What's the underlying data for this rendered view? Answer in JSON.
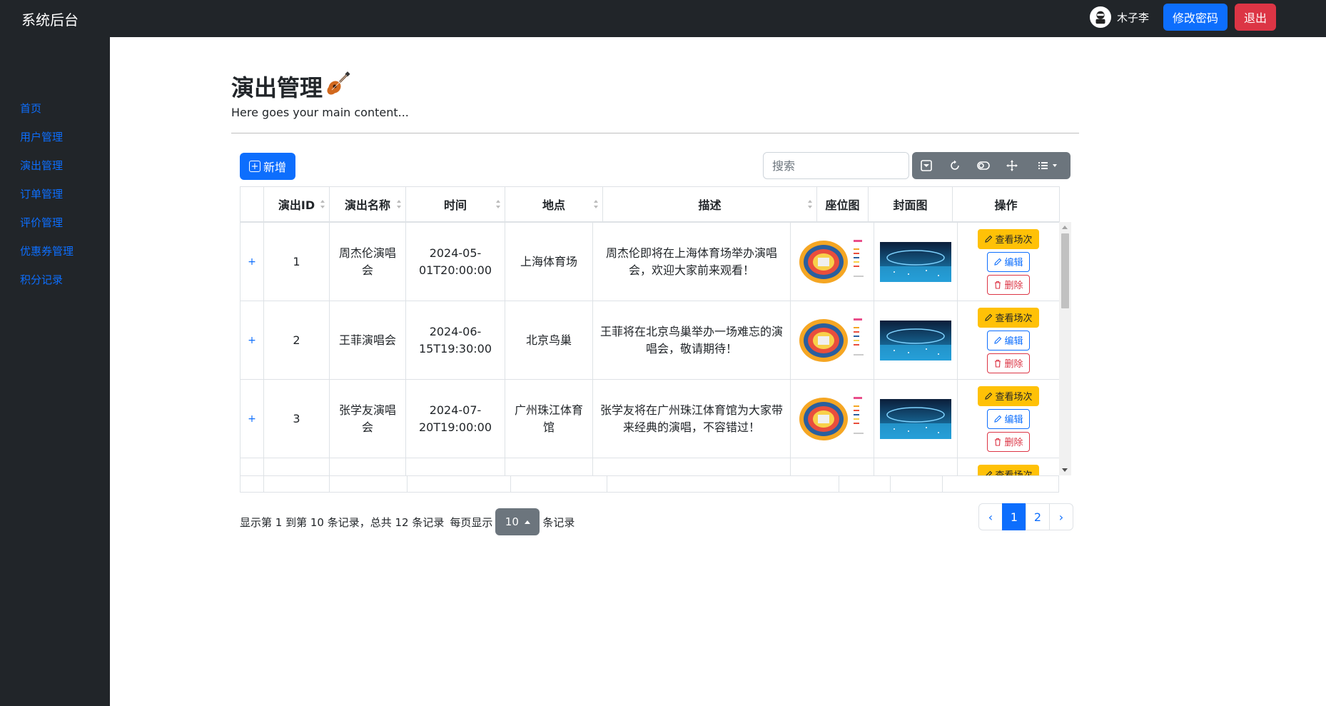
{
  "navbar": {
    "brand": "系统后台",
    "username": "木子李",
    "change_password_label": "修改密码",
    "logout_label": "退出"
  },
  "sidebar": {
    "items": [
      {
        "label": "首页"
      },
      {
        "label": "用户管理"
      },
      {
        "label": "演出管理"
      },
      {
        "label": "订单管理"
      },
      {
        "label": "评价管理"
      },
      {
        "label": "优惠券管理"
      },
      {
        "label": "积分记录"
      }
    ]
  },
  "main": {
    "title": "演出管理",
    "subtitle": "Here goes your main content...",
    "add_label": "新增",
    "search_placeholder": "搜索"
  },
  "table": {
    "columns": [
      "演出ID",
      "演出名称",
      "时间",
      "地点",
      "描述",
      "座位图",
      "封面图",
      "操作"
    ],
    "rows": [
      {
        "id": "1",
        "name": "周杰伦演唱会",
        "time": "2024-05-01T20:00:00",
        "place": "上海体育场",
        "desc": "周杰伦即将在上海体育场举办演唱会，欢迎大家前来观看！"
      },
      {
        "id": "2",
        "name": "王菲演唱会",
        "time": "2024-06-15T19:30:00",
        "place": "北京鸟巢",
        "desc": "王菲将在北京鸟巢举办一场难忘的演唱会，敬请期待！"
      },
      {
        "id": "3",
        "name": "张学友演唱会",
        "time": "2024-07-20T19:00:00",
        "place": "广州珠江体育馆",
        "desc": "张学友将在广州珠江体育馆为大家带来经典的演唱，不容错过！"
      },
      {
        "id": "",
        "name": "",
        "time": "",
        "place": "",
        "desc": ""
      }
    ],
    "expand_symbol": "+",
    "op_view": "查看场次",
    "op_edit": "编辑",
    "op_delete": "删除"
  },
  "pagination": {
    "info_prefix": "显示第 1 到第 10 条记录，总共 12 条记录",
    "per_page_label": "每页显示",
    "page_size": "10",
    "per_page_suffix": "条记录",
    "prev": "‹",
    "next": "›",
    "pages": [
      "1",
      "2"
    ]
  },
  "colors": {
    "primary": "#0d6efd",
    "danger": "#dc3545",
    "warning": "#ffc107",
    "secondary": "#6c757d",
    "dark": "#212529"
  }
}
